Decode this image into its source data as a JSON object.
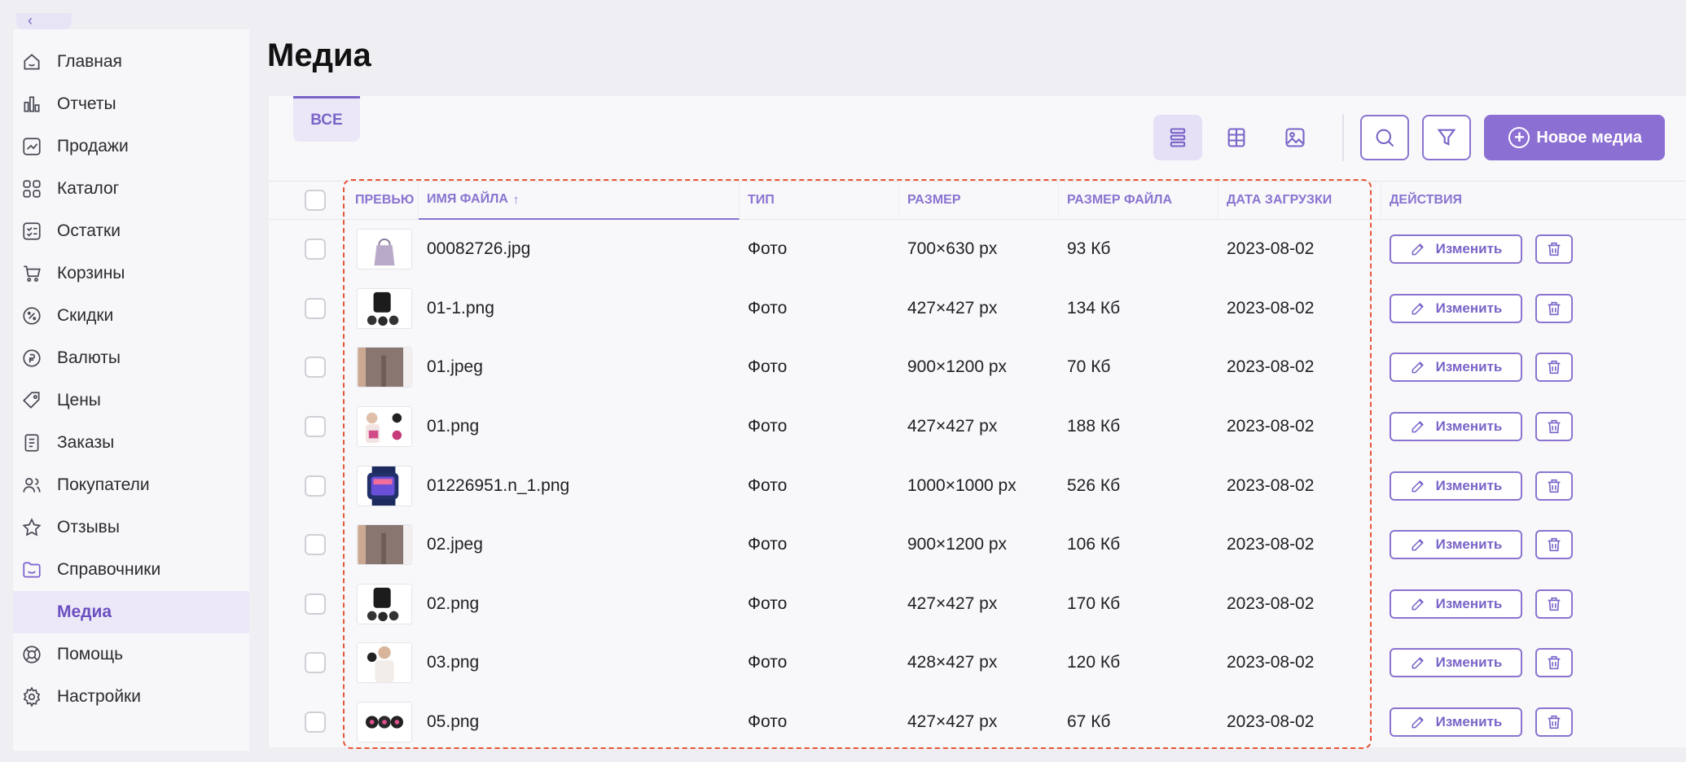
{
  "sidebar": {
    "collapse_icon": "chevron-left-icon",
    "items": [
      {
        "label": "Главная",
        "icon": "home-icon"
      },
      {
        "label": "Отчеты",
        "icon": "bar-chart-icon"
      },
      {
        "label": "Продажи",
        "icon": "sales-chart-icon"
      },
      {
        "label": "Каталог",
        "icon": "catalog-grid-icon"
      },
      {
        "label": "Остатки",
        "icon": "checklist-icon"
      },
      {
        "label": "Корзины",
        "icon": "cart-icon"
      },
      {
        "label": "Скидки",
        "icon": "discount-icon"
      },
      {
        "label": "Валюты",
        "icon": "currency-icon"
      },
      {
        "label": "Цены",
        "icon": "price-tag-icon"
      },
      {
        "label": "Заказы",
        "icon": "orders-icon"
      },
      {
        "label": "Покупатели",
        "icon": "users-icon"
      },
      {
        "label": "Отзывы",
        "icon": "star-icon"
      },
      {
        "label": "Справочники",
        "icon": "folder-icon"
      },
      {
        "label": "Медиа",
        "icon": ""
      },
      {
        "label": "Помощь",
        "icon": "help-lifebuoy-icon"
      },
      {
        "label": "Настройки",
        "icon": "gear-icon"
      }
    ],
    "active_item": "Медиа"
  },
  "page": {
    "title": "Медиа"
  },
  "tabs": [
    {
      "label": "ВСЕ",
      "active": true
    }
  ],
  "toolbar": {
    "views": [
      "list-view-icon",
      "grid-view-icon",
      "image-view-icon"
    ],
    "active_view": "list-view-icon",
    "new_media_label": "Новое медиа"
  },
  "table": {
    "headers": {
      "preview": "ПРЕВЬЮ",
      "filename": "ИМЯ ФАЙЛА",
      "type": "ТИП",
      "size": "РАЗМЕР",
      "filesize": "РАЗМЕР ФАЙЛА",
      "date": "ДАТА ЗАГРУЗКИ",
      "actions": "ДЕЙСТВИЯ"
    },
    "sorted_by": "filename",
    "edit_label": "Изменить",
    "rows": [
      {
        "name": "00082726.jpg",
        "type": "Фото",
        "size": "700×630 px",
        "filesize": "93 Кб",
        "date": "2023-08-02",
        "thumb": "bag"
      },
      {
        "name": "01-1.png",
        "type": "Фото",
        "size": "427×427 px",
        "filesize": "134 Кб",
        "date": "2023-08-02",
        "thumb": "gloves"
      },
      {
        "name": "01.jpeg",
        "type": "Фото",
        "size": "900×1200 px",
        "filesize": "70 Кб",
        "date": "2023-08-02",
        "thumb": "pants"
      },
      {
        "name": "01.png",
        "type": "Фото",
        "size": "427×427 px",
        "filesize": "188 Кб",
        "date": "2023-08-02",
        "thumb": "woman-gloves"
      },
      {
        "name": "01226951.n_1.png",
        "type": "Фото",
        "size": "1000×1000 px",
        "filesize": "526 Кб",
        "date": "2023-08-02",
        "thumb": "watch"
      },
      {
        "name": "02.jpeg",
        "type": "Фото",
        "size": "900×1200 px",
        "filesize": "106 Кб",
        "date": "2023-08-02",
        "thumb": "pants"
      },
      {
        "name": "02.png",
        "type": "Фото",
        "size": "427×427 px",
        "filesize": "170 Кб",
        "date": "2023-08-02",
        "thumb": "gloves"
      },
      {
        "name": "03.png",
        "type": "Фото",
        "size": "428×427 px",
        "filesize": "120 Кб",
        "date": "2023-08-02",
        "thumb": "woman"
      },
      {
        "name": "05.png",
        "type": "Фото",
        "size": "427×427 px",
        "filesize": "67 Кб",
        "date": "2023-08-02",
        "thumb": "gloves-pink"
      }
    ]
  },
  "colors": {
    "accent": "#8b6fd3",
    "highlight": "#e8553a"
  }
}
